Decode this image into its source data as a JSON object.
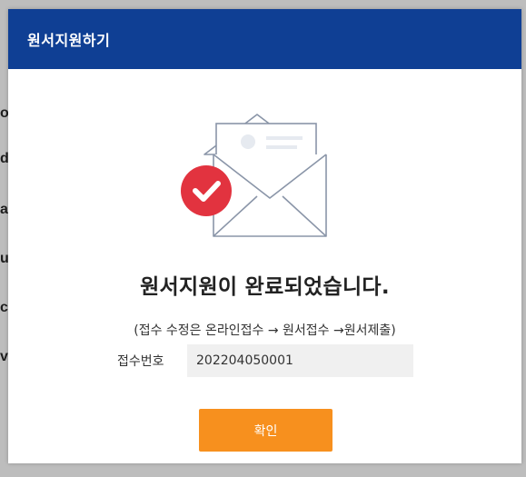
{
  "modal": {
    "title": "원서지원하기",
    "headline": "원서지원이 완료되었습니다.",
    "note": "(접수 수정은 온라인접수 → 원서접수 →원서제출)",
    "receipt_label": "접수번호",
    "receipt_number": "202204050001",
    "confirm_label": "확인"
  },
  "colors": {
    "header": "#0f3f94",
    "button": "#f7901e",
    "check_badge": "#e2333f"
  },
  "icons": {
    "illustration": "envelope-with-document-icon",
    "badge": "check-circle-icon"
  }
}
